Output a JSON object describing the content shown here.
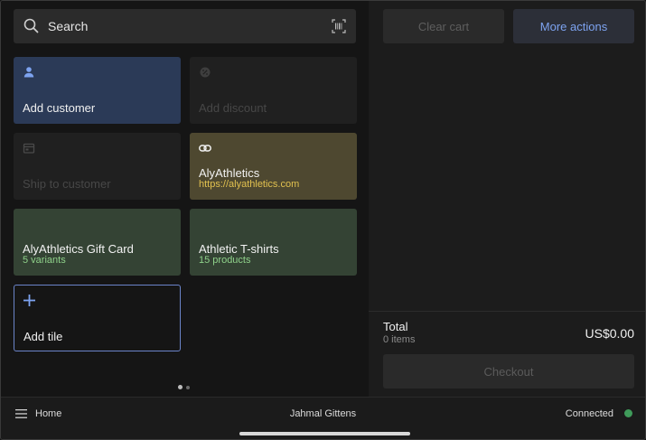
{
  "search": {
    "label": "Search"
  },
  "tiles": {
    "add_customer": {
      "title": "Add customer"
    },
    "add_discount": {
      "title": "Add discount"
    },
    "ship_to_customer": {
      "title": "Ship to customer"
    },
    "alyathletics": {
      "title": "AlyAthletics",
      "subtitle": "https://alyathletics.com"
    },
    "gift_card": {
      "title": "AlyAthletics Gift Card",
      "subtitle": "5 variants"
    },
    "tshirts": {
      "title": "Athletic T-shirts",
      "subtitle": "15 products"
    },
    "add_tile": {
      "title": "Add tile"
    }
  },
  "cart": {
    "clear_label": "Clear cart",
    "more_label": "More actions",
    "total_label": "Total",
    "items_label": "0 items",
    "amount": "US$0.00",
    "checkout_label": "Checkout"
  },
  "bottom_bar": {
    "home_label": "Home",
    "user_name": "Jahmal Gittens",
    "status_label": "Connected"
  },
  "colors": {
    "accent_blue": "#7da3f0",
    "connected_green": "#3f9b5a",
    "link_yellow": "#e1c14f",
    "variant_green": "#8fd18a"
  },
  "icons": [
    "search-icon",
    "barcode-scan-icon",
    "person-icon",
    "discount-icon",
    "ship-icon",
    "link-icon",
    "plus-icon",
    "menu-icon"
  ]
}
